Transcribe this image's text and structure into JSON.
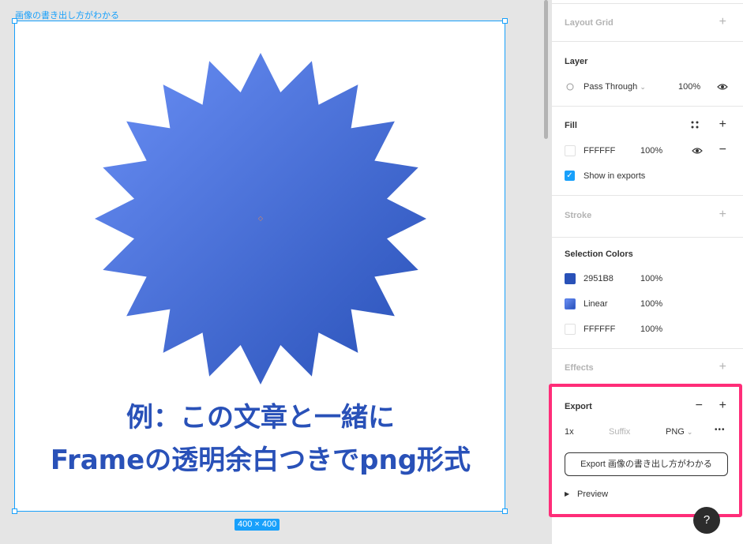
{
  "canvas": {
    "frame_label": "画像の書き出し方がわかる",
    "caption_line1": "例：この文章と一緒に",
    "caption_line2": "Frameの透明余白つきでpng形式",
    "size_badge": "400 × 400",
    "star_gradient": [
      "#6a8ff5",
      "#2951b8"
    ]
  },
  "panel": {
    "layout_grid": {
      "title": "Layout Grid",
      "add": "+"
    },
    "layer": {
      "title": "Layer",
      "blend": "Pass Through",
      "opacity": "100%"
    },
    "fill": {
      "title": "Fill",
      "color": "FFFFFF",
      "opacity": "100%",
      "show_in_exports": "Show in exports",
      "add": "+",
      "remove": "−"
    },
    "stroke": {
      "title": "Stroke",
      "add": "+"
    },
    "selection_colors": {
      "title": "Selection Colors",
      "items": [
        {
          "label": "2951B8",
          "opacity": "100%",
          "color": "#2951b8"
        },
        {
          "label": "Linear",
          "opacity": "100%",
          "color": "#4a72e0"
        },
        {
          "label": "FFFFFF",
          "opacity": "100%",
          "color": "#ffffff"
        }
      ]
    },
    "effects": {
      "title": "Effects",
      "add": "+"
    },
    "export": {
      "title": "Export",
      "remove": "−",
      "add": "+",
      "scale": "1x",
      "suffix_placeholder": "Suffix",
      "format": "PNG",
      "more": "•••",
      "button": "Export 画像の書き出し方がわかる",
      "preview": "Preview"
    }
  },
  "help": "?"
}
